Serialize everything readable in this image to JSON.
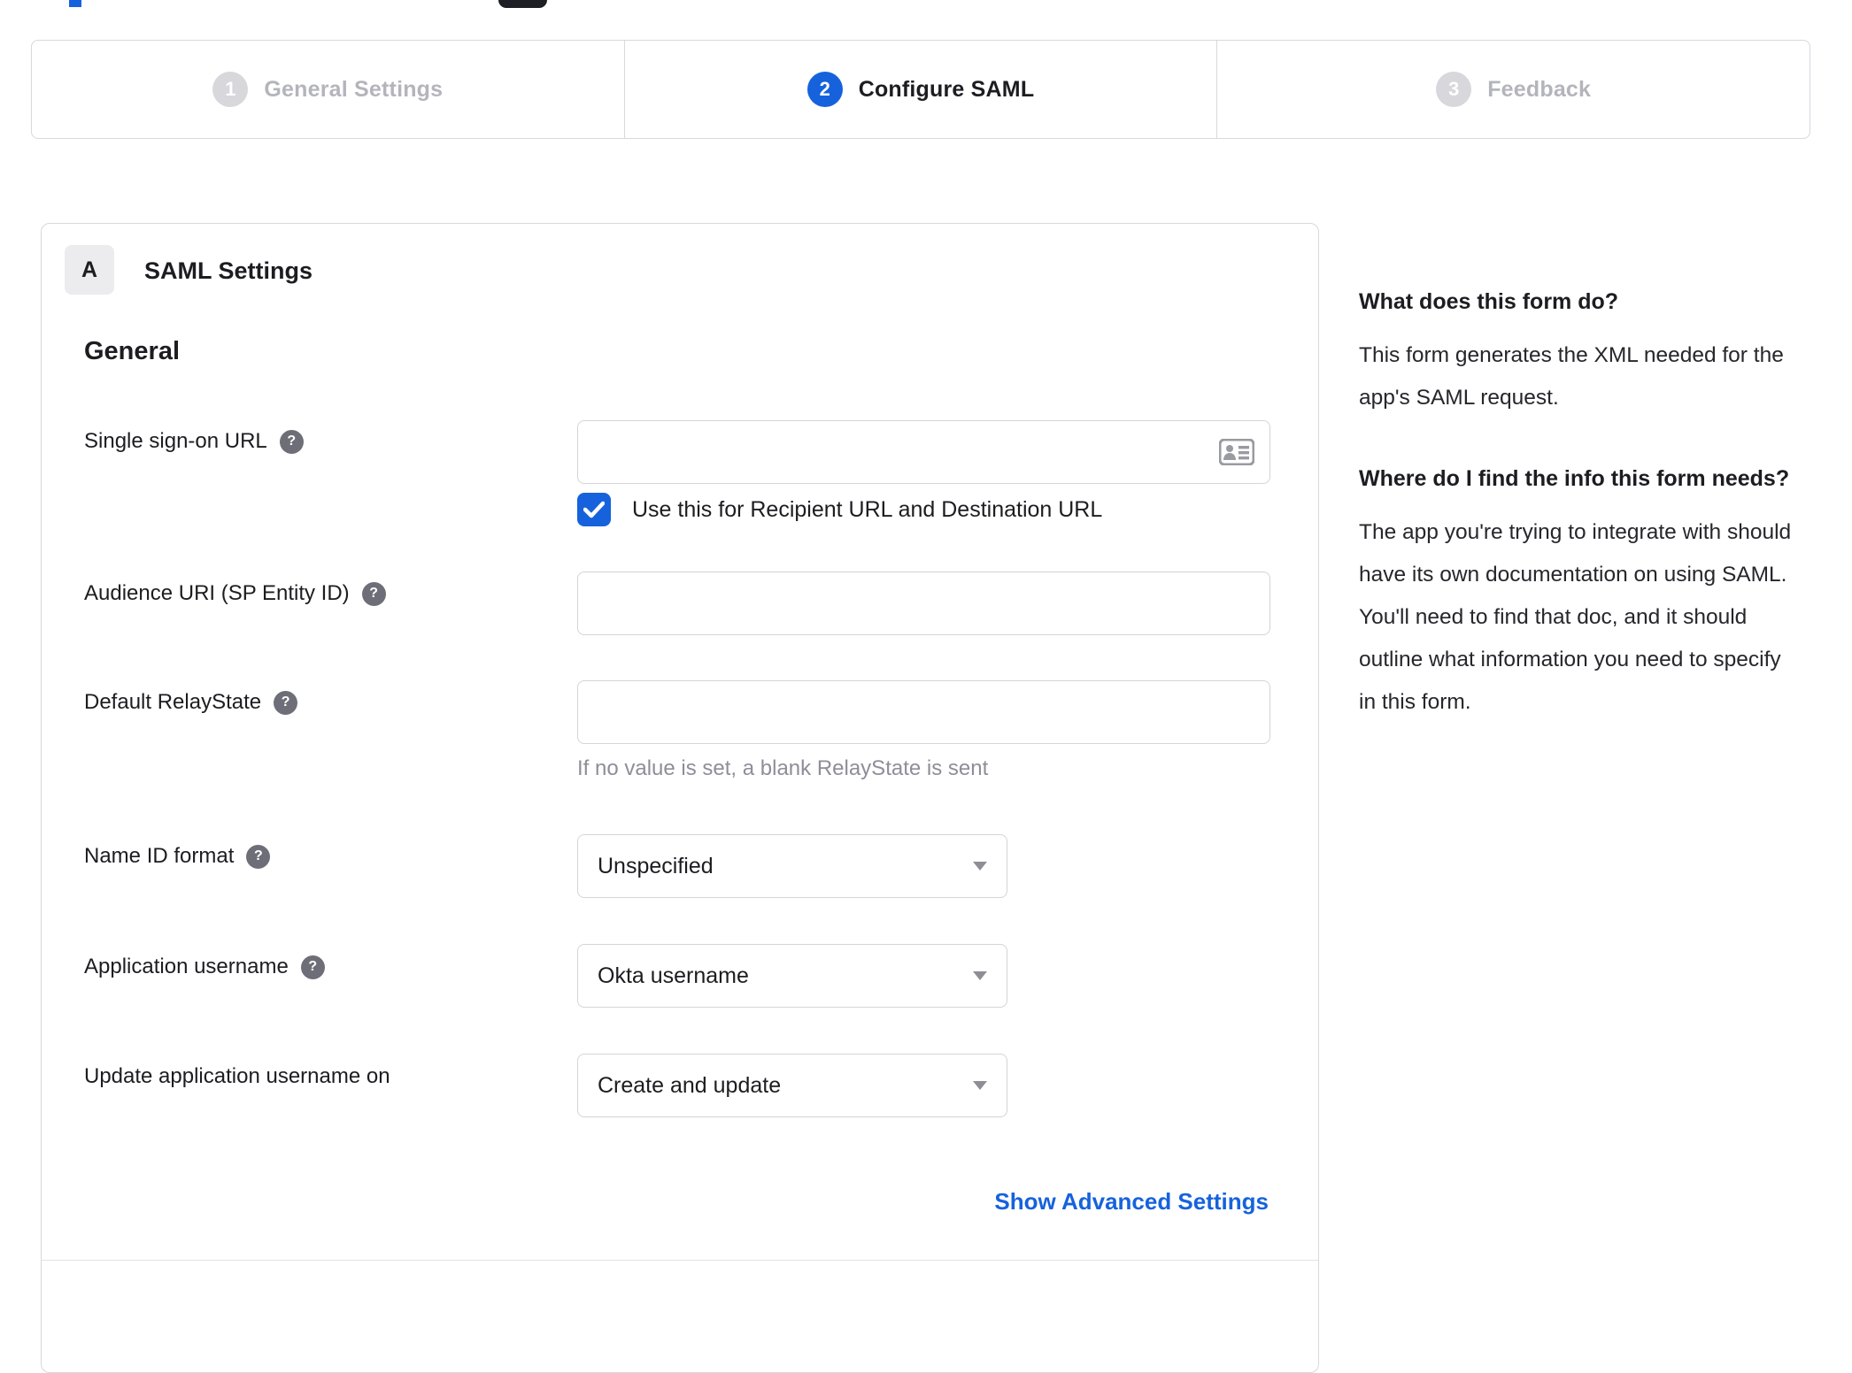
{
  "colors": {
    "accent_blue": "#1662dd",
    "inactive_gray": "#b4b4bc",
    "text_dark": "#1d1d21",
    "hint_gray": "#8e8e99"
  },
  "icons": {
    "help_glyph": "?"
  },
  "stepper": {
    "steps": [
      {
        "number": "1",
        "label": "General Settings",
        "state": "inactive"
      },
      {
        "number": "2",
        "label": "Configure SAML",
        "state": "active"
      },
      {
        "number": "3",
        "label": "Feedback",
        "state": "inactive"
      }
    ]
  },
  "form": {
    "section_badge": "A",
    "section_title": "SAML Settings",
    "group_title": "General",
    "fields": {
      "sso_url": {
        "label": "Single sign-on URL",
        "value": "",
        "checkbox_label": "Use this for Recipient URL and Destination URL",
        "checkbox_checked": true
      },
      "audience_uri": {
        "label": "Audience URI (SP Entity ID)",
        "value": ""
      },
      "relay_state": {
        "label": "Default RelayState",
        "value": "",
        "hint": "If no value is set, a blank RelayState is sent"
      },
      "name_id_format": {
        "label": "Name ID format",
        "value": "Unspecified"
      },
      "app_username": {
        "label": "Application username",
        "value": "Okta username"
      },
      "update_app_username": {
        "label": "Update application username on",
        "value": "Create and update"
      }
    },
    "advanced_link": "Show Advanced Settings"
  },
  "sidebar": {
    "sections": [
      {
        "heading": "What does this form do?",
        "body": "This form generates the XML needed for the app's SAML request."
      },
      {
        "heading": "Where do I find the info this form needs?",
        "body": "The app you're trying to integrate with should have its own documentation on using SAML. You'll need to find that doc, and it should outline what information you need to specify in this form."
      }
    ]
  }
}
